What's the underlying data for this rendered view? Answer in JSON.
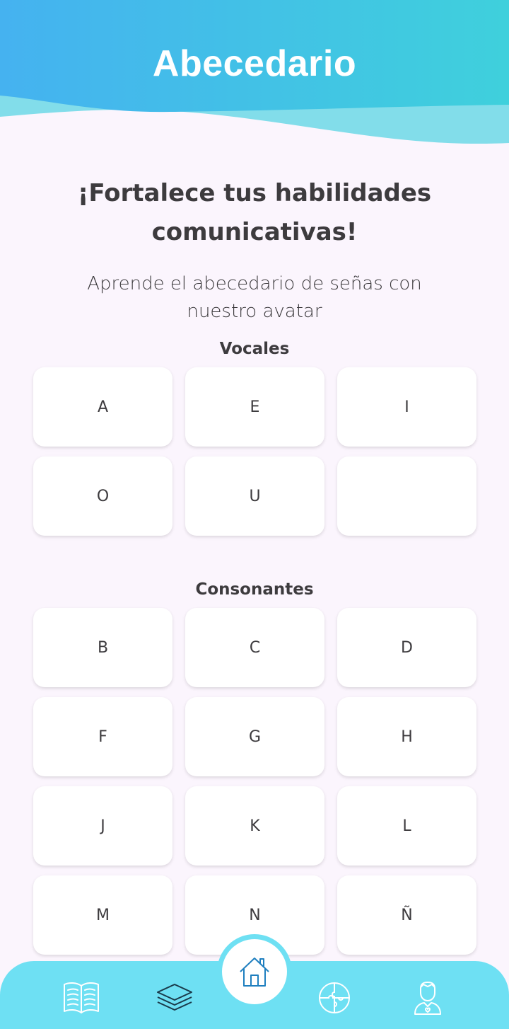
{
  "header": {
    "title": "Abecedario"
  },
  "intro": {
    "headline_line1": "¡Fortalece tus habilidades",
    "headline_line2": "comunicativas!",
    "sub_line1": "Aprende el abecedario de señas con",
    "sub_line2": "nuestro avatar"
  },
  "vowels": {
    "title": "Vocales",
    "letters": [
      "A",
      "E",
      "I",
      "O",
      "U",
      ""
    ]
  },
  "consonants": {
    "title": "Consonantes",
    "letters": [
      "B",
      "C",
      "D",
      "F",
      "G",
      "H",
      "J",
      "K",
      "L",
      "M",
      "N",
      "Ñ"
    ]
  },
  "bottom_nav": {
    "items": [
      {
        "icon": "book-icon"
      },
      {
        "icon": "layers-icon"
      },
      {
        "icon": "home-icon",
        "active": true
      },
      {
        "icon": "puzzle-icon"
      },
      {
        "icon": "profile-icon"
      }
    ]
  },
  "colors": {
    "header_gradient_start": "#45b4ee",
    "header_gradient_end": "#3ed0dc",
    "nav_background": "#6ee0f3",
    "icon_stroke": "#1f7fbf",
    "page_background": "#fbf5fd"
  }
}
